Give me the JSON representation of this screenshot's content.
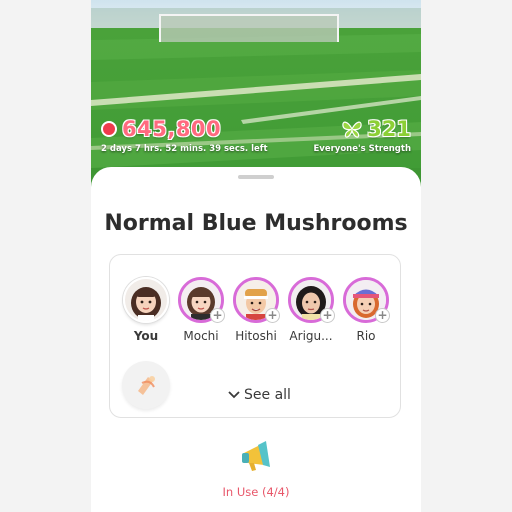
{
  "hud": {
    "points": "645,800",
    "timer": "2 days 7 hrs. 52 mins. 39 secs. left",
    "strength": "321",
    "strength_label": "Everyone's Strength"
  },
  "sheet": {
    "title": "Normal Blue Mushrooms",
    "members": [
      {
        "name": "You"
      },
      {
        "name": "Mochi"
      },
      {
        "name": "Hitoshi"
      },
      {
        "name": "Arigu..."
      },
      {
        "name": "Rio"
      }
    ],
    "see_all": "See all",
    "in_use": "In Use (4/4)"
  },
  "colors": {
    "points": "#ff6a7f",
    "strength": "#8ccf35",
    "friend_ring": "#d86bd8",
    "in_use": "#e8576a"
  }
}
